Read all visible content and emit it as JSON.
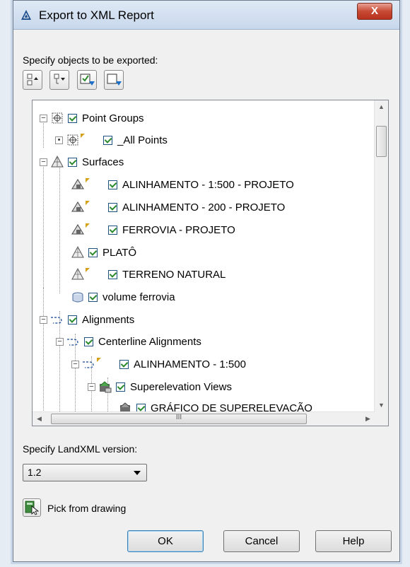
{
  "dialog": {
    "title": "Export to XML Report",
    "close_label": "X",
    "specify_objects_label": "Specify objects to be exported:",
    "toolbar": [
      "select-all-icon",
      "clear-all-icon",
      "check-selected-icon",
      "uncheck-selected-icon"
    ]
  },
  "tree": {
    "items": [
      {
        "label": "Point Groups",
        "level": 0,
        "expander": "−",
        "icon": "point-group-icon",
        "flag": false
      },
      {
        "label": "_All Points",
        "level": 1,
        "expander": "•",
        "icon": "point-group-icon",
        "flag": true
      },
      {
        "label": "Surfaces",
        "level": 0,
        "expander": "−",
        "icon": "surface-icon",
        "flag": false
      },
      {
        "label": "ALINHAMENTO - 1:500 - PROJETO",
        "level": 1,
        "expander": "",
        "icon": "surface-icon",
        "flag": true
      },
      {
        "label": "ALINHAMENTO - 200 - PROJETO",
        "level": 1,
        "expander": "",
        "icon": "surface-icon",
        "flag": true
      },
      {
        "label": "FERROVIA - PROJETO",
        "level": 1,
        "expander": "",
        "icon": "surface-icon",
        "flag": true
      },
      {
        "label": "PLATÔ",
        "level": 1,
        "expander": "",
        "icon": "surface-icon",
        "flag": false
      },
      {
        "label": "TERRENO NATURAL",
        "level": 1,
        "expander": "",
        "icon": "surface-icon",
        "flag": true
      },
      {
        "label": "volume ferrovia",
        "level": 1,
        "expander": "",
        "icon": "volume-surface-icon",
        "flag": false
      },
      {
        "label": "Alignments",
        "level": 0,
        "expander": "−",
        "icon": "alignment-icon",
        "flag": false
      },
      {
        "label": "Centerline Alignments",
        "level": 1,
        "expander": "−",
        "icon": "alignment-icon",
        "flag": false
      },
      {
        "label": "ALINHAMENTO - 1:500",
        "level": 2,
        "expander": "−",
        "icon": "alignment-icon",
        "flag": true
      },
      {
        "label": "Superelevation Views",
        "level": 3,
        "expander": "−",
        "icon": "superelevation-view-icon",
        "flag": false
      },
      {
        "label": "GRÁFICO DE SUPERELEVAÇÃO",
        "level": 4,
        "expander": "",
        "icon": "superelevation-view-icon",
        "flag": false
      }
    ],
    "hscroll_grip": "III"
  },
  "landxml": {
    "label": "Specify LandXML version:",
    "selected": "1.2"
  },
  "pick": {
    "label": "Pick from drawing"
  },
  "buttons": {
    "ok": "OK",
    "cancel": "Cancel",
    "help": "Help"
  },
  "colors": {
    "check": "#2b8a2b",
    "flag": "#d4a017",
    "close": "#c74a35"
  }
}
